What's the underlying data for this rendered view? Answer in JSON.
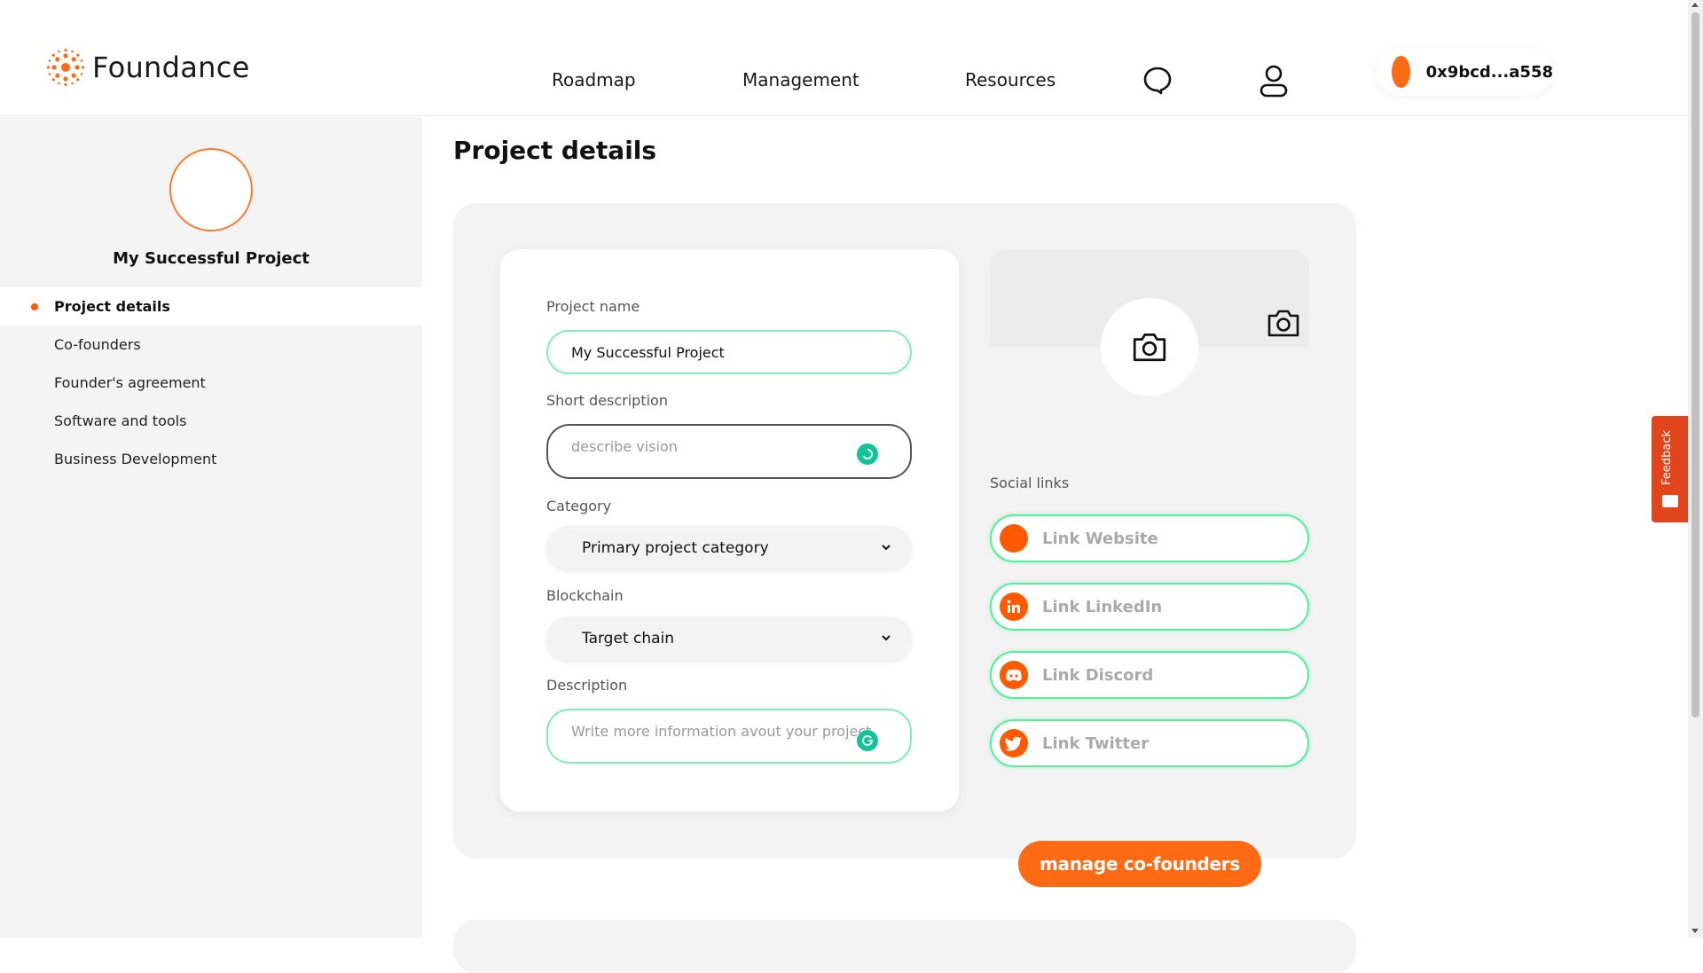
{
  "header": {
    "brand": "Foundance",
    "nav": [
      "Roadmap",
      "Management",
      "Resources"
    ],
    "icons": [
      "chat-icon",
      "user-icon"
    ],
    "wallet_address": "0x9bcd...a558"
  },
  "sidebar": {
    "project_name": "My Successful Project",
    "items": [
      {
        "label": "Project details",
        "active": true
      },
      {
        "label": "Co-founders",
        "active": false
      },
      {
        "label": "Founder's agreement",
        "active": false
      },
      {
        "label": "Software and tools",
        "active": false
      },
      {
        "label": "Business Development",
        "active": false
      }
    ]
  },
  "main": {
    "title": "Project details",
    "form": {
      "project_name_label": "Project name",
      "project_name_value": "My Successful Project",
      "short_desc_label": "Short description",
      "short_desc_placeholder": "describe vision",
      "category_label": "Category",
      "category_value": "Primary project category",
      "blockchain_label": "Blockchain",
      "blockchain_value": "Target chain",
      "description_label": "Description",
      "description_placeholder": "Write more information avout your project"
    },
    "social": {
      "title": "Social links",
      "links": [
        {
          "label": "Link Website",
          "icon": "website-icon"
        },
        {
          "label": "Link LinkedIn",
          "icon": "linkedin-icon"
        },
        {
          "label": "Link Discord",
          "icon": "discord-icon"
        },
        {
          "label": "Link Twitter",
          "icon": "twitter-icon"
        }
      ]
    },
    "manage_button": "manage co-founders"
  },
  "feedback_label": "Feedback",
  "colors": {
    "accent": "#ff6a13",
    "input_border": "#55ee9a",
    "feedback": "#e2451b"
  }
}
